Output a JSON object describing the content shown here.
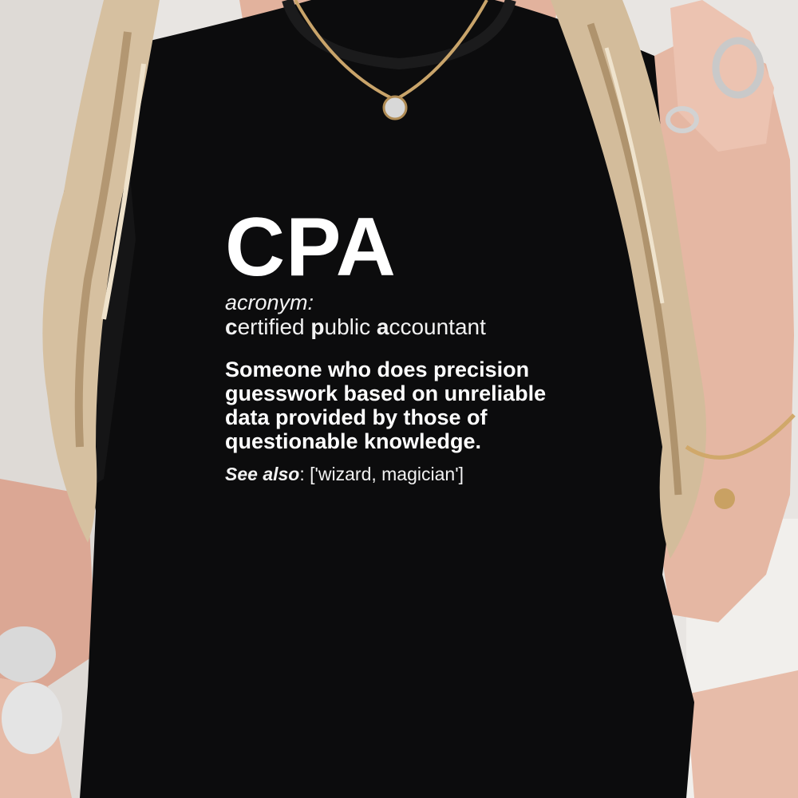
{
  "shirt_print": {
    "word": "CPA",
    "part_of_speech": "acronym:",
    "expansion": [
      {
        "initial": "c",
        "rest": "ertified "
      },
      {
        "initial": "p",
        "rest": "ublic "
      },
      {
        "initial": "a",
        "rest": "ccountant"
      }
    ],
    "definition_lines": [
      "Someone who does precision",
      "guesswork based on unreliable",
      "data provided by those of",
      "questionable knowledge."
    ],
    "see_also_label": "See also",
    "see_also_value": ": ['wizard, magician']"
  },
  "colors": {
    "shirt": "#0c0c0d",
    "print": "#ffffff",
    "skin": "#e6b9a6",
    "hair": "#d8c3a4",
    "background": "#e9e6e3"
  }
}
